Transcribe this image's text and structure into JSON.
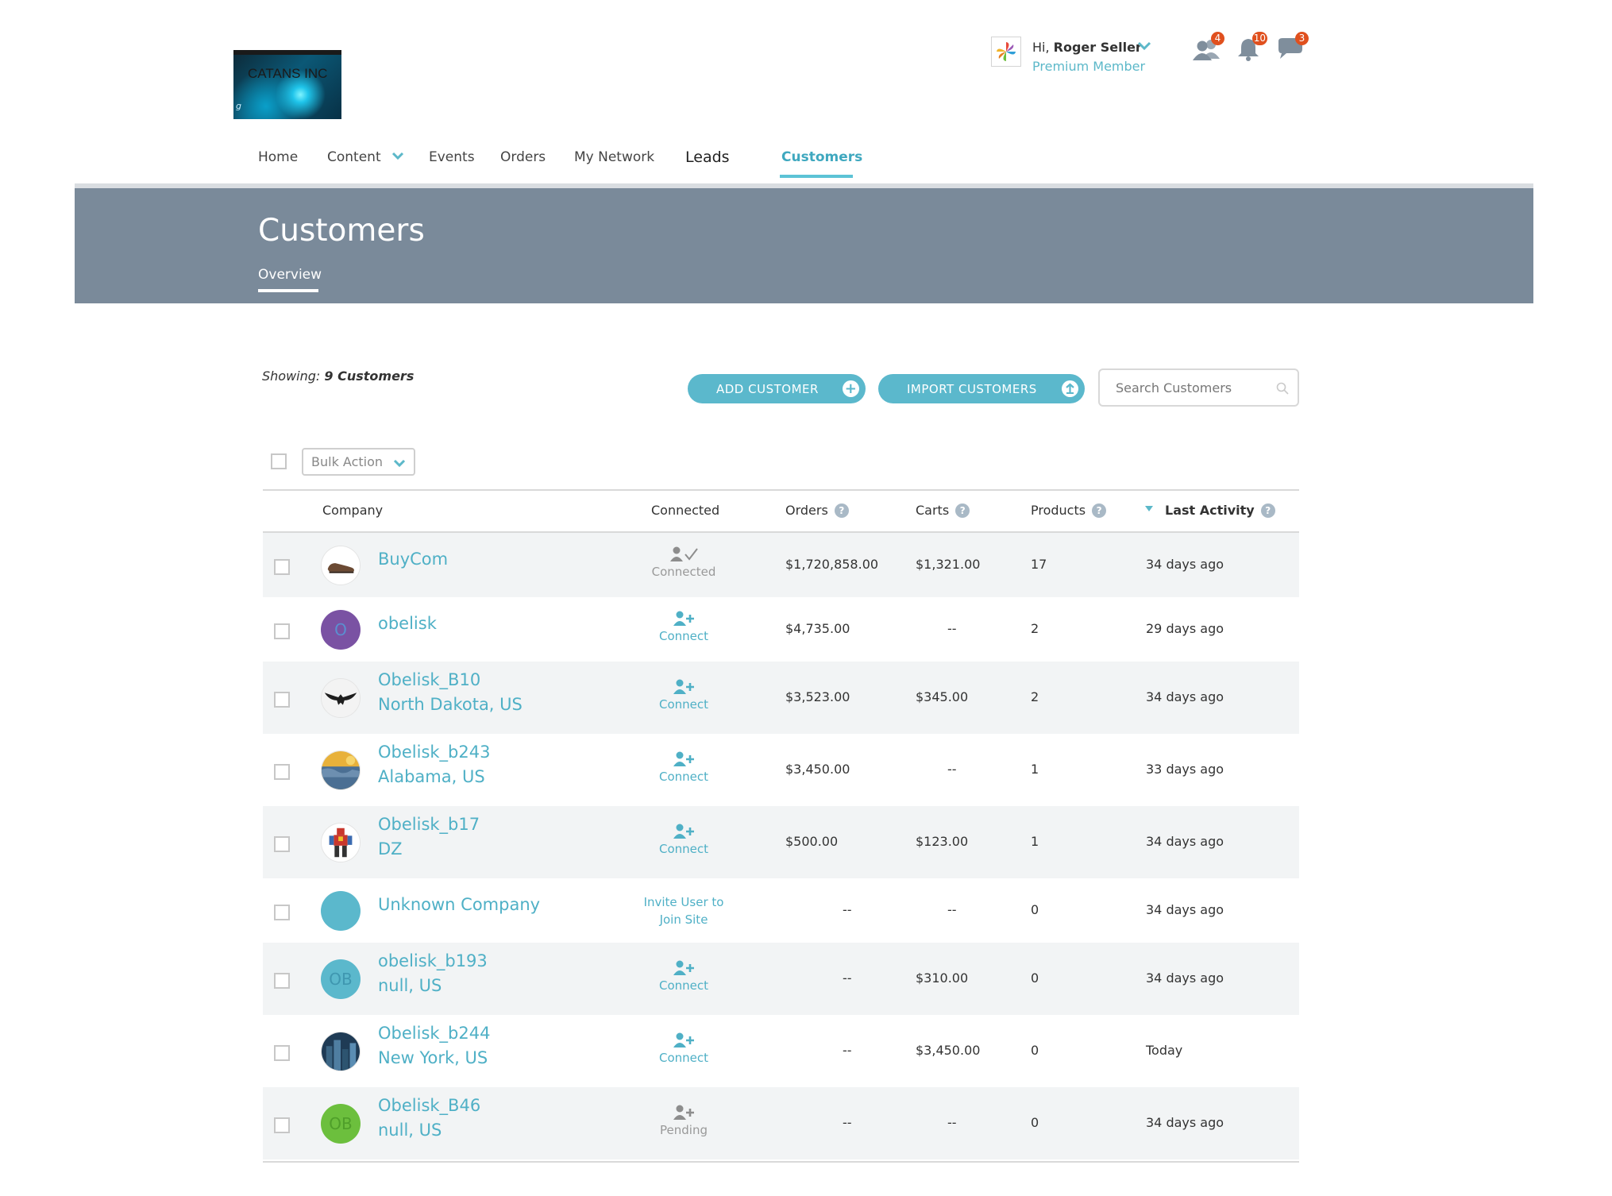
{
  "logo": {
    "text": "CATANS INC",
    "small": "g"
  },
  "user": {
    "greeting_prefix": "Hi, ",
    "name": "Roger Seller",
    "level": "Premium Member"
  },
  "header_icons": [
    {
      "name": "network-users-icon",
      "count": "4"
    },
    {
      "name": "bell-icon",
      "count": "10"
    },
    {
      "name": "chat-icon",
      "count": "3"
    }
  ],
  "nav": {
    "home": "Home",
    "content": "Content",
    "events": "Events",
    "orders": "Orders",
    "my_network": "My Network",
    "leads": "Leads",
    "customers": "Customers"
  },
  "banner": {
    "title": "Customers",
    "tab": "Overview"
  },
  "toolbar": {
    "showing_label": "Showing:",
    "showing_value": "9 Customers",
    "add_customer": "ADD CUSTOMER",
    "import_customers": "IMPORT CUSTOMERS",
    "search_placeholder": "Search Customers",
    "bulk_action": "Bulk Action"
  },
  "columns": {
    "company": "Company",
    "connected": "Connected",
    "orders": "Orders",
    "carts": "Carts",
    "products": "Products",
    "last_activity": "Last Activity"
  },
  "accent_color": "#4fb0c6",
  "rows": [
    {
      "company": "BuyCom",
      "location": "",
      "avatar": "shoe",
      "conn_status": "Connected",
      "orders": "$1,720,858.00",
      "carts": "$1,321.00",
      "products": "17",
      "last": "34 days ago"
    },
    {
      "company": "obelisk",
      "location": "",
      "avatar": "initial",
      "initials": "O",
      "avatar_color": "#7a52a3",
      "initials_color": "#5a8fd0",
      "conn_status": "Connect",
      "orders": "$4,735.00",
      "carts": "--",
      "products": "2",
      "last": "29 days ago"
    },
    {
      "company": "Obelisk_B10",
      "location": "North Dakota, US",
      "avatar": "eagle",
      "conn_status": "Connect",
      "orders": "$3,523.00",
      "carts": "$345.00",
      "products": "2",
      "last": "34 days ago"
    },
    {
      "company": "Obelisk_b243",
      "location": "Alabama, US",
      "avatar": "photo-water",
      "conn_status": "Connect",
      "orders": "$3,450.00",
      "carts": "--",
      "products": "1",
      "last": "33 days ago"
    },
    {
      "company": "Obelisk_b17",
      "location": "DZ",
      "avatar": "robot",
      "conn_status": "Connect",
      "orders": "$500.00",
      "carts": "$123.00",
      "products": "1",
      "last": "34 days ago"
    },
    {
      "company": "Unknown Company",
      "location": "",
      "avatar": "initial",
      "initials": "",
      "avatar_color": "#5bb8cc",
      "initials_color": "#5bb8cc",
      "conn_status": "Invite User to Join Site",
      "orders": "--",
      "carts": "--",
      "products": "0",
      "last": "34 days ago"
    },
    {
      "company": "obelisk_b193",
      "location": "null, US",
      "avatar": "initial",
      "initials": "OB",
      "avatar_color": "#5bb8cc",
      "initials_color": "#3f97b0",
      "conn_status": "Connect",
      "orders": "--",
      "carts": "$310.00",
      "products": "0",
      "last": "34 days ago"
    },
    {
      "company": "Obelisk_b244",
      "location": "New York, US",
      "avatar": "photo-city",
      "conn_status": "Connect",
      "orders": "--",
      "carts": "$3,450.00",
      "products": "0",
      "last": "Today"
    },
    {
      "company": "Obelisk_B46",
      "location": "null, US",
      "avatar": "initial",
      "initials": "OB",
      "avatar_color": "#6cbf3d",
      "initials_color": "#4f9f2a",
      "conn_status": "Pending",
      "orders": "--",
      "carts": "--",
      "products": "0",
      "last": "34 days ago"
    }
  ]
}
